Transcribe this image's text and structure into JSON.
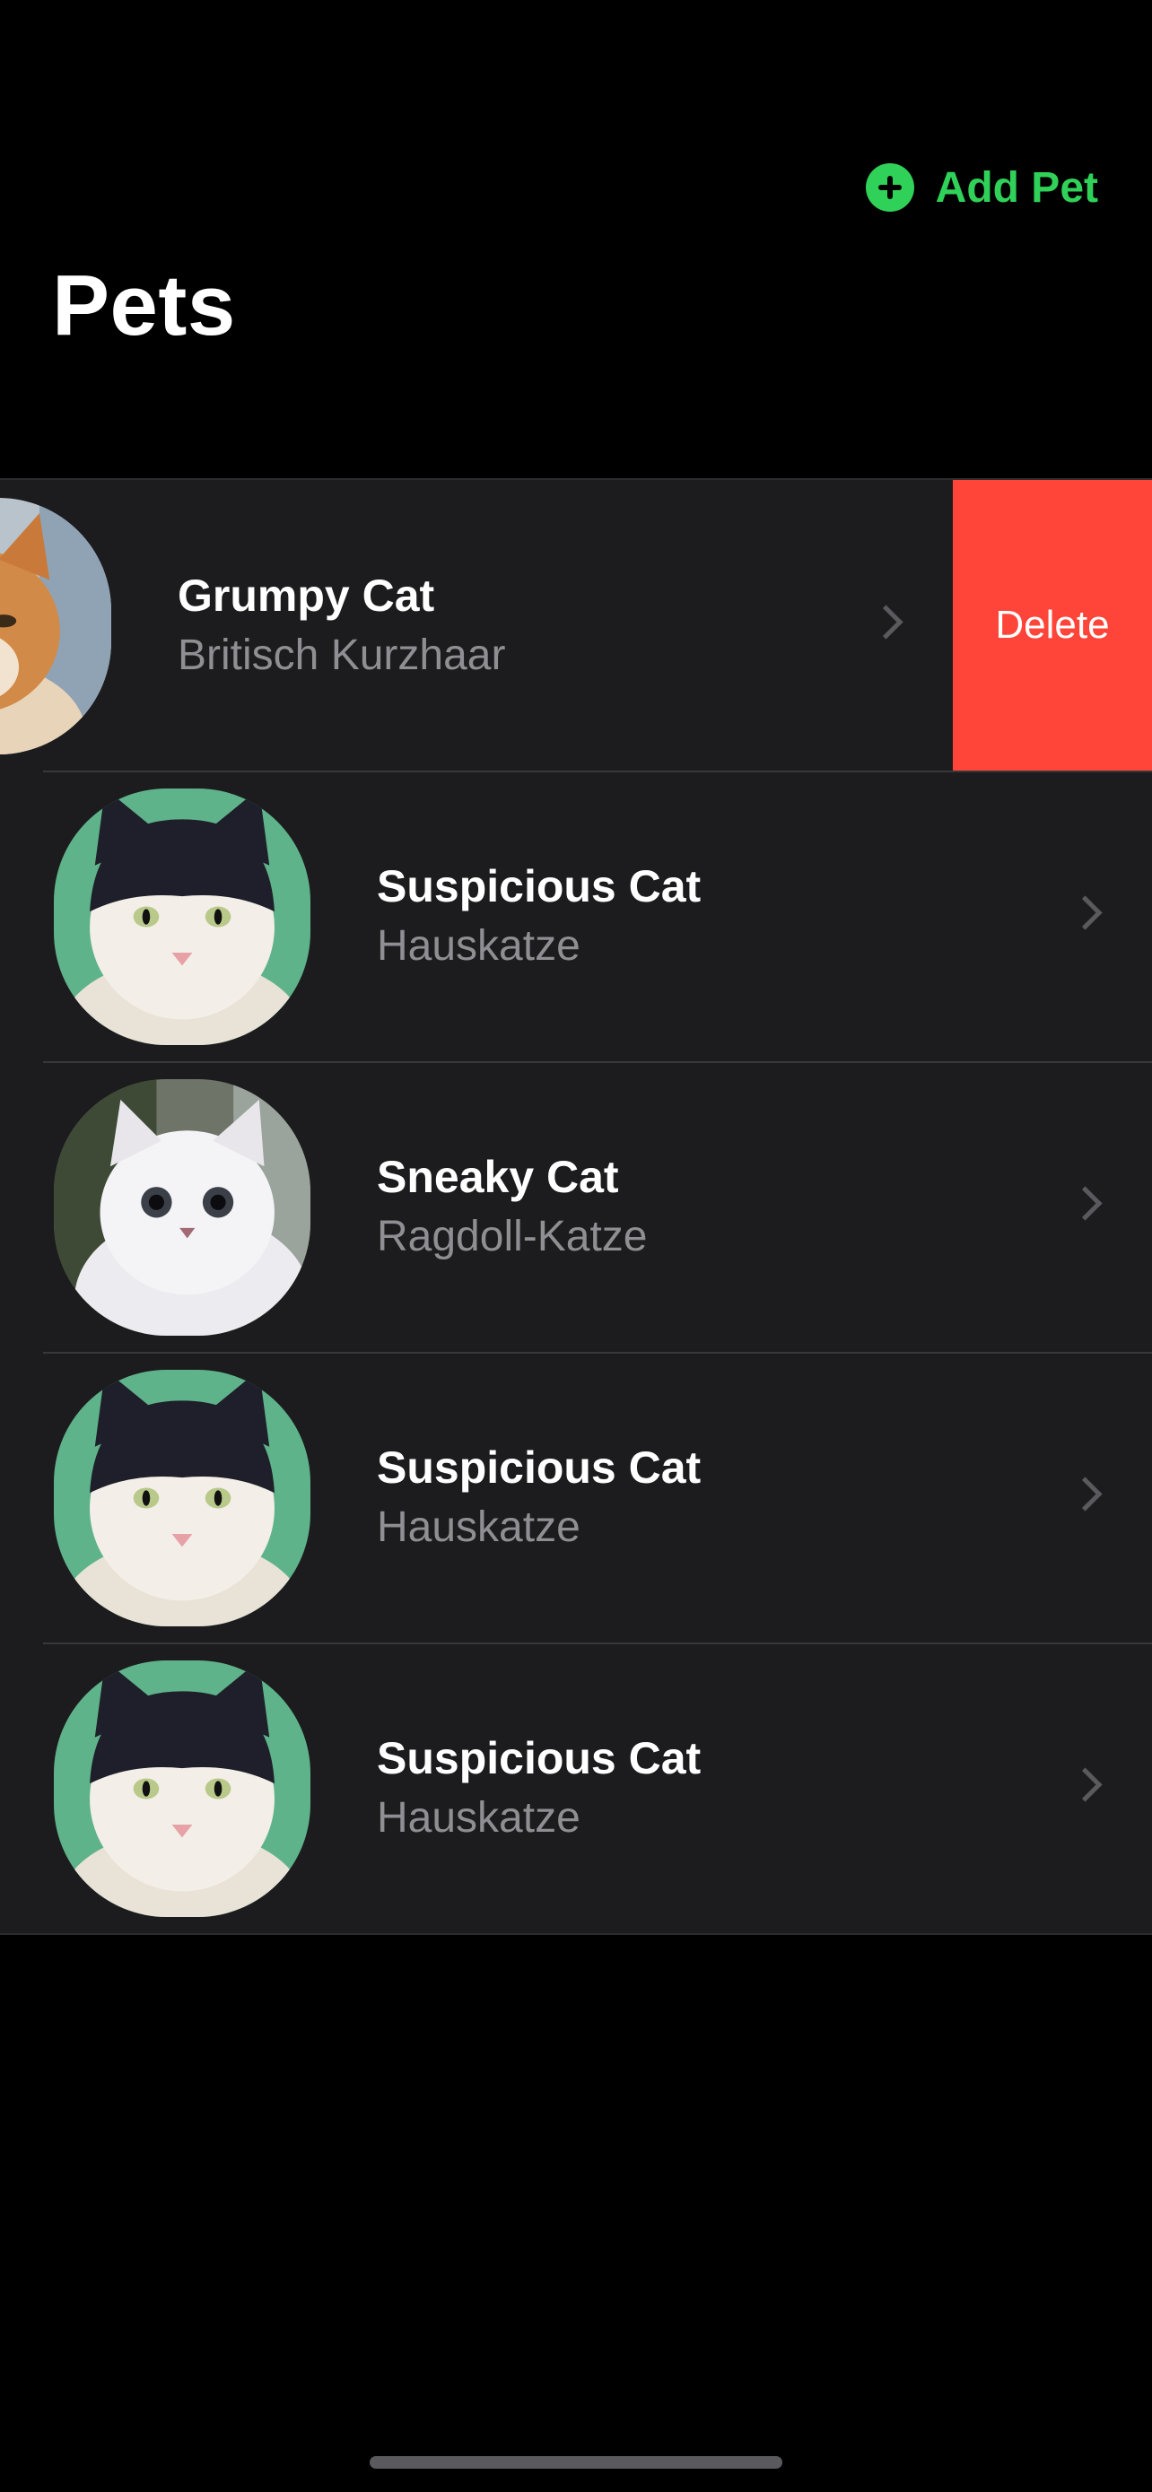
{
  "nav": {
    "add_label": "Add Pet",
    "add_icon": "plus-circle-icon",
    "title": "Pets"
  },
  "pets": [
    {
      "name": "Grumpy Cat",
      "breed": "Britisch Kurzhaar",
      "swiped": true,
      "photo": "orange-cat-photo"
    },
    {
      "name": "Suspicious Cat",
      "breed": "Hauskatze",
      "swiped": false,
      "photo": "black-white-cat-photo"
    },
    {
      "name": "Sneaky Cat",
      "breed": "Ragdoll-Katze",
      "swiped": false,
      "photo": "white-fluffy-cat-photo"
    },
    {
      "name": "Suspicious Cat",
      "breed": "Hauskatze",
      "swiped": false,
      "photo": "black-white-cat-photo"
    },
    {
      "name": "Suspicious Cat",
      "breed": "Hauskatze",
      "swiped": false,
      "photo": "black-white-cat-photo"
    }
  ],
  "swipe_action": {
    "label": "Delete"
  },
  "colors": {
    "accent": "#30d158",
    "destructive": "#ff453a",
    "row_background": "#1c1c1e",
    "secondary_text": "#8e8e93"
  }
}
